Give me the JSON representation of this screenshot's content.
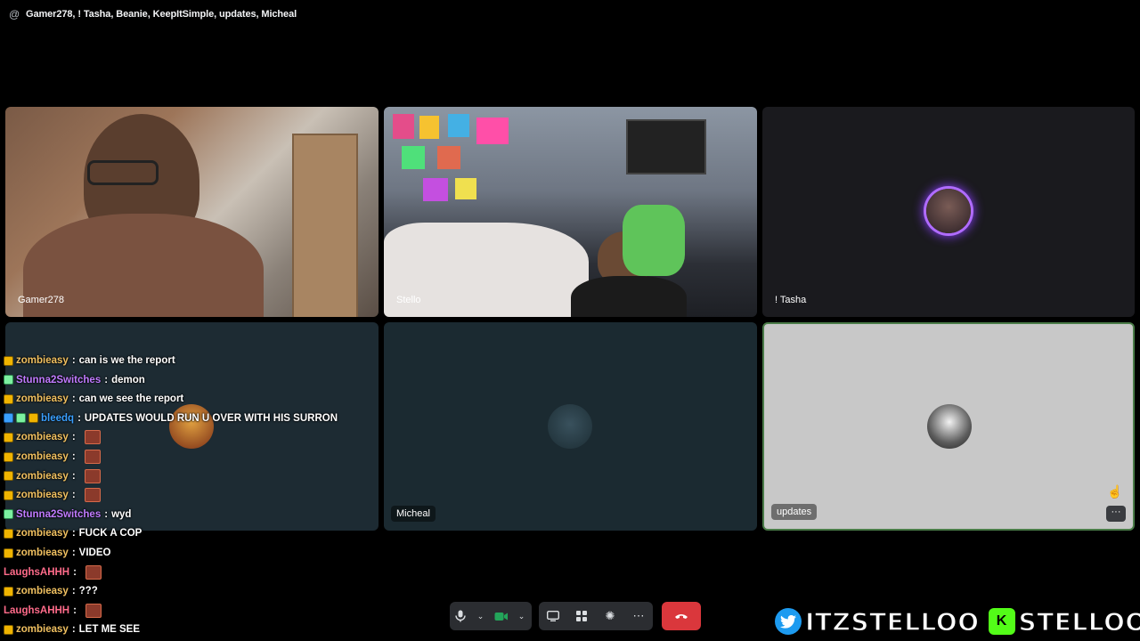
{
  "header": {
    "at_symbol": "@",
    "call_title": "Gamer278, ! Tasha, Beanie, KeepItSimple, updates, Micheal"
  },
  "tiles": [
    {
      "label": "Gamer278"
    },
    {
      "label": "Stello"
    },
    {
      "label": "! Tasha"
    },
    {
      "label": ""
    },
    {
      "label": "Micheal"
    },
    {
      "label": "updates",
      "more": "···"
    }
  ],
  "chat": [
    {
      "user": "zombieasy",
      "sep": ":",
      "msg": "can is we the report",
      "color": "#f0c060",
      "badges": [
        "b1"
      ]
    },
    {
      "user": "Stunna2Switches",
      "sep": ":",
      "msg": "demon",
      "color": "#c07bff",
      "badges": [
        "b3"
      ]
    },
    {
      "user": "zombieasy",
      "sep": ":",
      "msg": "can we see the report",
      "color": "#f0c060",
      "badges": [
        "b1"
      ]
    },
    {
      "user": "bleedq",
      "sep": ":",
      "msg": "UPDATES WOULD RUN U OVER WITH HIS SURRON",
      "color": "#3aa0ff",
      "badges": [
        "b2",
        "b3",
        "b1"
      ]
    },
    {
      "user": "zombieasy",
      "sep": ":",
      "msg": "",
      "color": "#f0c060",
      "badges": [
        "b1"
      ],
      "emote": true
    },
    {
      "user": "zombieasy",
      "sep": ":",
      "msg": "",
      "color": "#f0c060",
      "badges": [
        "b1"
      ],
      "emote": true
    },
    {
      "user": "zombieasy",
      "sep": ":",
      "msg": "",
      "color": "#f0c060",
      "badges": [
        "b1"
      ],
      "emote": true
    },
    {
      "user": "zombieasy",
      "sep": ":",
      "msg": "",
      "color": "#f0c060",
      "badges": [
        "b1"
      ],
      "emote": true
    },
    {
      "user": "Stunna2Switches",
      "sep": ":",
      "msg": "wyd",
      "color": "#c07bff",
      "badges": [
        "b3"
      ]
    },
    {
      "user": "zombieasy",
      "sep": ":",
      "msg": "FUCK A COP",
      "color": "#f0c060",
      "badges": [
        "b1"
      ]
    },
    {
      "user": "zombieasy",
      "sep": ":",
      "msg": "VIDEO",
      "color": "#f0c060",
      "badges": [
        "b1"
      ]
    },
    {
      "user": "LaughsAHHH",
      "sep": ":",
      "msg": "",
      "color": "#ff6b8a",
      "badges": [],
      "emote": true
    },
    {
      "user": "zombieasy",
      "sep": ":",
      "msg": "???",
      "color": "#f0c060",
      "badges": [
        "b1"
      ]
    },
    {
      "user": "LaughsAHHH",
      "sep": ":",
      "msg": "",
      "color": "#ff6b8a",
      "badges": [],
      "emote": true
    },
    {
      "user": "zombieasy",
      "sep": ":",
      "msg": "LET ME SEE",
      "color": "#f0c060",
      "badges": [
        "b1"
      ]
    }
  ],
  "controls": {
    "mic_icon": "microphone-icon",
    "chevron_icon": "chevron-down-icon",
    "camera_icon": "camera-icon",
    "screenshare_icon": "screen-share-icon",
    "activities_icon": "activities-icon",
    "soundboard_icon": "soundboard-icon",
    "more_icon": "more-icon",
    "hangup_icon": "hangup-icon"
  },
  "socials": {
    "twitter_handle": "ITZSTELLOO",
    "kick_handle": "STELLOOO",
    "kick_letter": "K"
  },
  "colors": {
    "accent_green": "#23a55a",
    "hangup_red": "#da373c",
    "speaking_ring": "#b06cff"
  }
}
